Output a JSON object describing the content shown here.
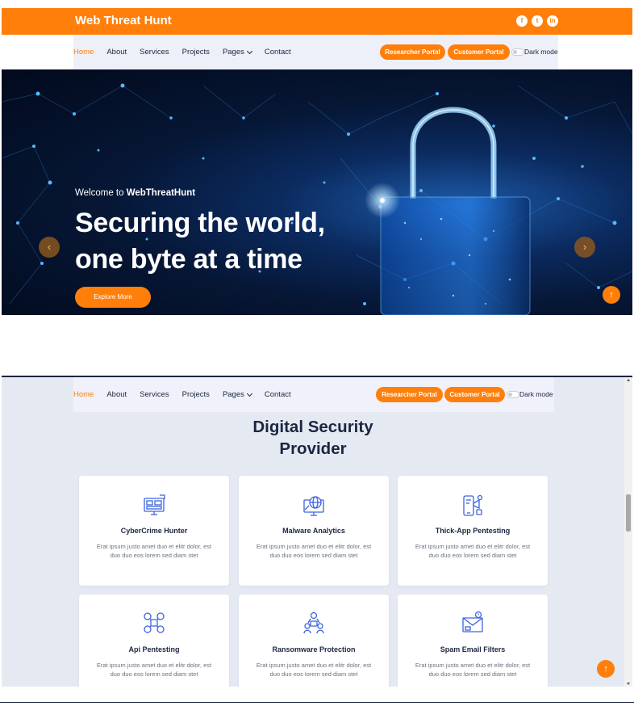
{
  "brand": "Web Threat Hunt",
  "social": {
    "facebook": "f",
    "twitter": "t",
    "linkedin": "in"
  },
  "nav": {
    "items": [
      "Home",
      "About",
      "Services",
      "Projects",
      "Pages",
      "Contact"
    ],
    "researcher_portal": "Researcher Portal",
    "customer_portal": "Customer Portal",
    "dark_mode": "Dark mode"
  },
  "hero": {
    "welcome_prefix": "Welcome to ",
    "welcome_brand": "WebThreatHunt",
    "headline_line1": "Securing the world,",
    "headline_line2": "one byte at a time",
    "cta": "Explore More",
    "prev": "‹",
    "next": "›"
  },
  "back_to_top": "↑",
  "services": {
    "title_line1": "Digital Security",
    "title_line2": "Provider",
    "cards": [
      {
        "title": "CyberCrime Hunter",
        "desc": "Erat ipsum justo amet duo et elitr dolor, est duo duo eos lorem sed diam stet",
        "icon": "cyber-monitor-icon"
      },
      {
        "title": "Malware Analytics",
        "desc": "Erat ipsum justo amet duo et elitr dolor, est duo duo eos lorem sed diam stet",
        "icon": "globe-monitor-icon"
      },
      {
        "title": "Thick-App Pentesting",
        "desc": "Erat ipsum justo amet duo et elitr dolor, est duo duo eos lorem sed diam stet",
        "icon": "mobile-megaphone-icon"
      },
      {
        "title": "Api Pentesting",
        "desc": "Erat ipsum justo amet duo et elitr dolor, est duo duo eos lorem sed diam stet",
        "icon": "api-network-icon"
      },
      {
        "title": "Ransomware Protection",
        "desc": "Erat ipsum justo amet duo et elitr dolor, est duo duo eos lorem sed diam stet",
        "icon": "people-network-icon"
      },
      {
        "title": "Spam Email Filters",
        "desc": "Erat ipsum justo amet duo et elitr dolor, est duo duo eos lorem sed diam stet",
        "icon": "email-filter-icon"
      }
    ]
  },
  "colors": {
    "accent": "#ff7f0a",
    "nav_bg": "#eef0f9",
    "section_bg": "#e5e9f2",
    "text_dark": "#1b2640",
    "icon_blue": "#3d63dd"
  }
}
